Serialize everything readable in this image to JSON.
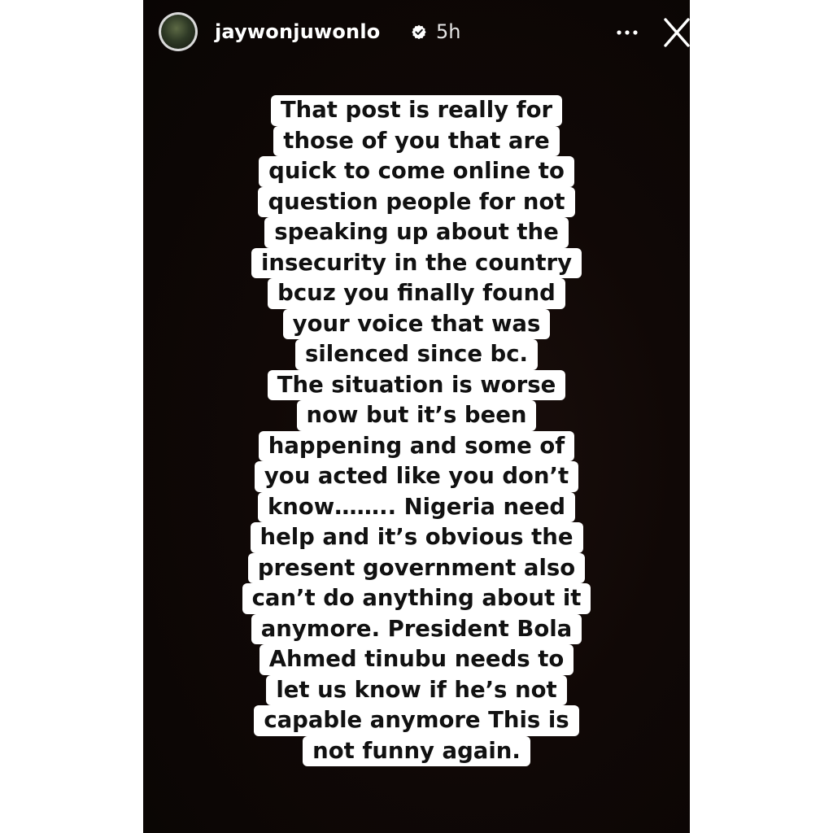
{
  "header": {
    "username": "jaywonjuwonlo",
    "timestamp": "5h"
  },
  "caption": {
    "lines": [
      "That post is really for",
      "those of you that are",
      "quick to come online to",
      "question people for not",
      "speaking up about the",
      "insecurity in the country",
      "bcuz you finally found",
      "your voice that was",
      "silenced since bc.",
      "The situation is worse",
      "now but it’s been",
      "happening and some of",
      "you acted like you don’t",
      "know…….. Nigeria need",
      "help and it’s obvious the",
      "present government also",
      "can’t do anything about it",
      "anymore.  President Bola",
      "Ahmed tinubu needs to",
      "let us know if he’s not",
      "capable anymore   This is",
      "not funny again."
    ]
  },
  "colors": {
    "background": "#100806",
    "caption_box": "#ffffff",
    "caption_text": "#111111",
    "header_text": "#ffffff"
  },
  "icons": {
    "avatar": "profile-avatar",
    "verified": "verified-badge-icon",
    "more": "more-options-icon",
    "close": "close-icon"
  }
}
